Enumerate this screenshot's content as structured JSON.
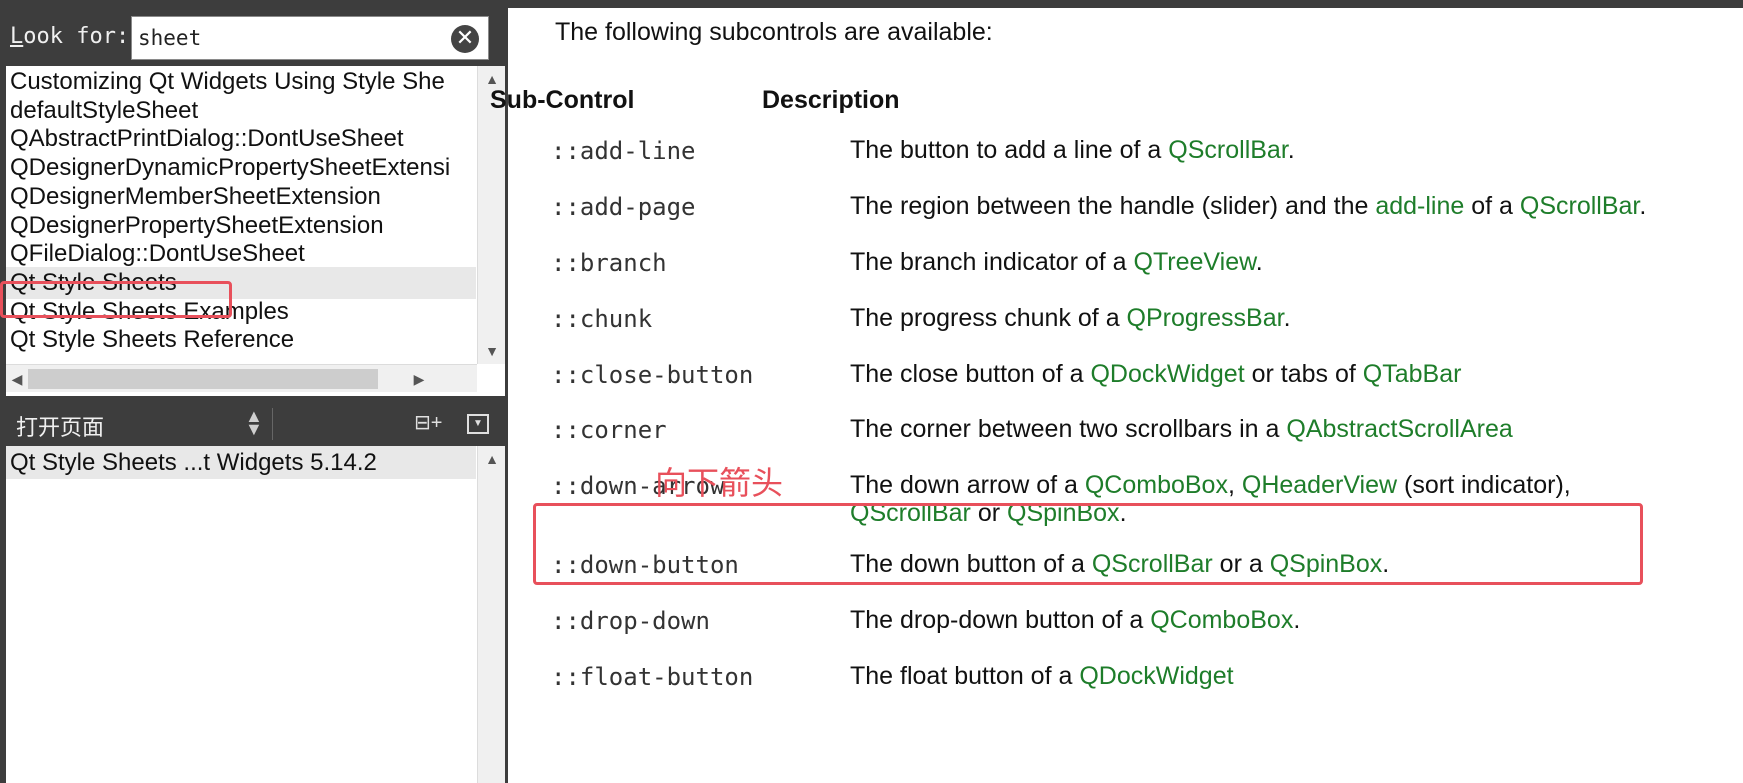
{
  "sidebar": {
    "look_for_label": "Look for:",
    "look_for_hotkey": "L",
    "look_for_rest": "ook for:",
    "search_value": "sheet",
    "results": [
      "Customizing Qt Widgets Using Style She",
      "defaultStyleSheet",
      "QAbstractPrintDialog::DontUseSheet",
      "QDesignerDynamicPropertySheetExtensi",
      "QDesignerMemberSheetExtension",
      "QDesignerPropertySheetExtension",
      "QFileDialog::DontUseSheet",
      "Qt Style Sheets",
      "Qt Style Sheets Examples",
      "Qt Style Sheets Reference"
    ],
    "open_pages_label": "打开页面",
    "open_pages": [
      "Qt Style Sheets ...t Widgets 5.14.2"
    ]
  },
  "doc": {
    "intro": "The following subcontrols are available:",
    "col_subcontrol": "Sub-Control",
    "col_description": "Description",
    "annotation": "向下箭头",
    "rows": [
      {
        "code": "::add-line",
        "d": [
          "The button to add a line of a ",
          "QScrollBar",
          "."
        ]
      },
      {
        "code": "::add-page",
        "d": [
          "The region between the handle (slider) and the ",
          "add-line",
          " of a ",
          "QScrollBar",
          "."
        ]
      },
      {
        "code": "::branch",
        "d": [
          "The branch indicator of a ",
          "QTreeView",
          "."
        ]
      },
      {
        "code": "::chunk",
        "d": [
          "The progress chunk of a ",
          "QProgressBar",
          "."
        ]
      },
      {
        "code": "::close-button",
        "d": [
          "The close button of a ",
          "QDockWidget",
          " or tabs of ",
          "QTabBar",
          ""
        ]
      },
      {
        "code": "::corner",
        "d": [
          "The corner between two scrollbars in a ",
          "QAbstractScrollArea",
          ""
        ]
      },
      {
        "code": "::down-arrow",
        "d": [
          "The down arrow of a ",
          "QComboBox",
          ", ",
          "QHeaderView",
          " (sort indicator),"
        ],
        "d2": [
          "",
          "QScrollBar",
          " or ",
          "QSpinBox",
          "."
        ]
      },
      {
        "code": "::down-button",
        "d": [
          "The down button of a ",
          "QScrollBar",
          " or a ",
          "QSpinBox",
          "."
        ]
      },
      {
        "code": "::drop-down",
        "d": [
          "The drop-down button of a ",
          "QComboBox",
          "."
        ]
      },
      {
        "code": "::float-button",
        "d": [
          "The float button of a ",
          "QDockWidget",
          ""
        ]
      }
    ]
  },
  "colors": {
    "link": "#1e7d2a",
    "highlight": "#e8505b",
    "chrome": "#3d3d3d"
  }
}
